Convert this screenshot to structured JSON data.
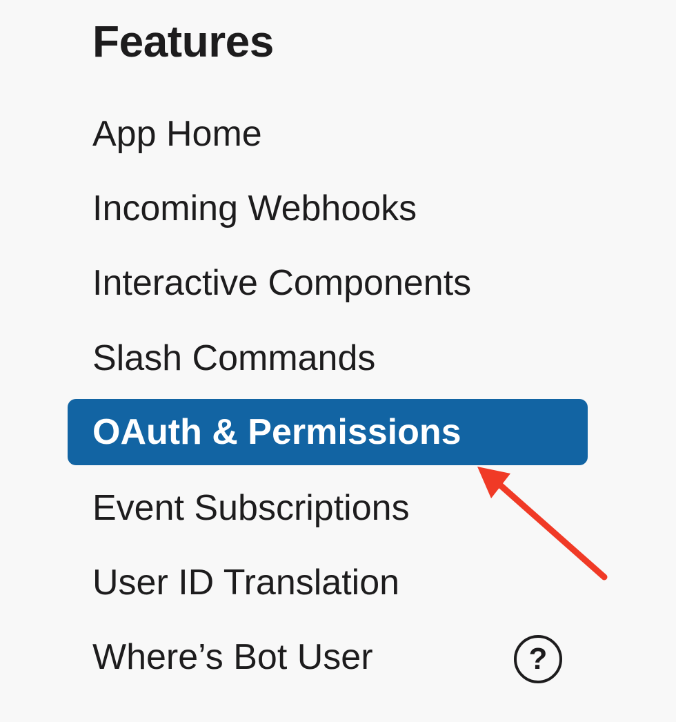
{
  "sidebar": {
    "section_title": "Features",
    "items": [
      {
        "label": "App Home"
      },
      {
        "label": "Incoming Webhooks"
      },
      {
        "label": "Interactive Components"
      },
      {
        "label": "Slash Commands"
      },
      {
        "label": "OAuth & Permissions",
        "active": true
      },
      {
        "label": "Event Subscriptions"
      },
      {
        "label": "User ID Translation"
      },
      {
        "label": "Where’s Bot User"
      }
    ],
    "help_icon": {
      "icon": "question-circle-icon",
      "glyph": "?"
    }
  },
  "colors": {
    "background": "#f8f8f8",
    "active_bg": "#1264a3",
    "active_text": "#ffffff",
    "text": "#1d1c1d",
    "annotation_arrow": "#f03a26"
  }
}
